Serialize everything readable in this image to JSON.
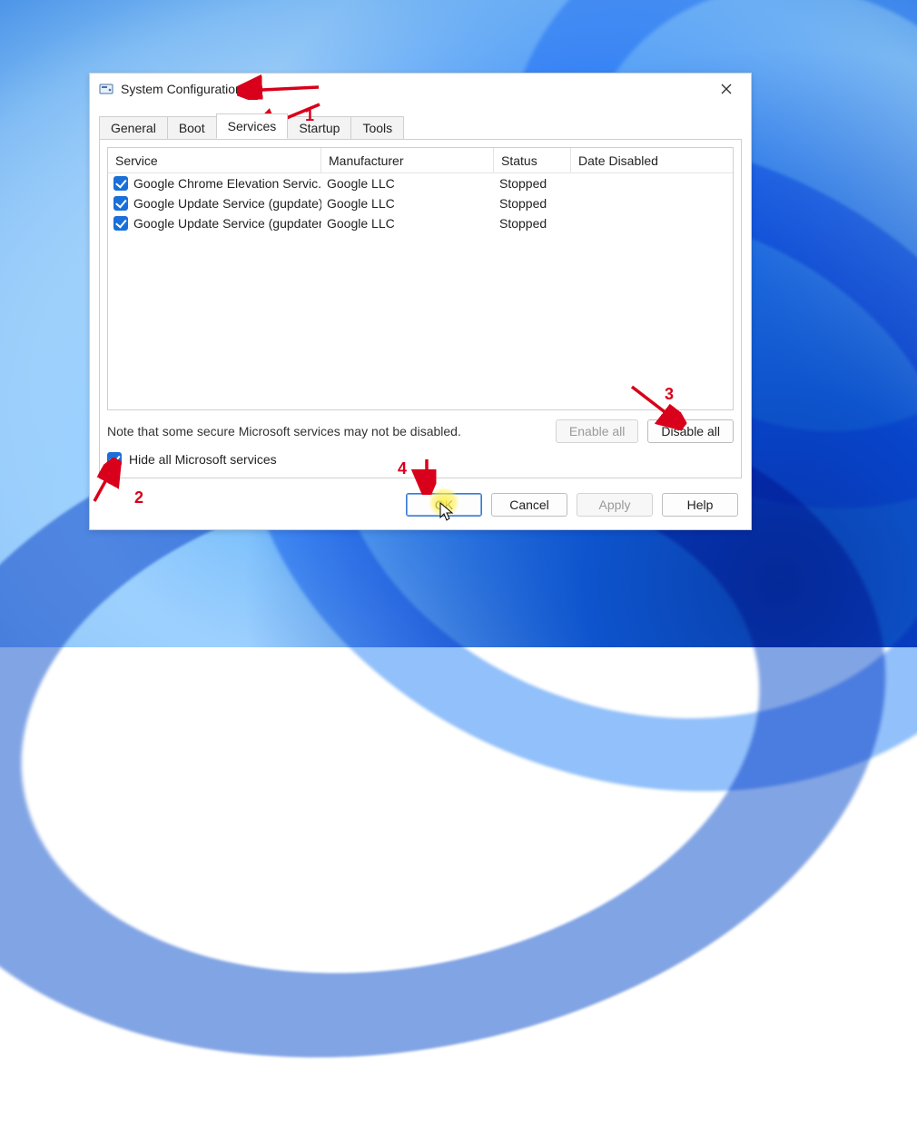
{
  "window": {
    "title": "System Configuration"
  },
  "tabs": {
    "general": "General",
    "boot": "Boot",
    "services": "Services",
    "startup": "Startup",
    "tools": "Tools",
    "active": "services"
  },
  "list": {
    "columns": {
      "service": "Service",
      "manufacturer": "Manufacturer",
      "status": "Status",
      "date_disabled": "Date Disabled"
    },
    "rows": [
      {
        "checked": true,
        "service": "Google Chrome Elevation Servic...",
        "manufacturer": "Google LLC",
        "status": "Stopped",
        "date_disabled": ""
      },
      {
        "checked": true,
        "service": "Google Update Service (gupdate)",
        "manufacturer": "Google LLC",
        "status": "Stopped",
        "date_disabled": ""
      },
      {
        "checked": true,
        "service": "Google Update Service (gupdatem)",
        "manufacturer": "Google LLC",
        "status": "Stopped",
        "date_disabled": ""
      }
    ]
  },
  "note": "Note that some secure Microsoft services may not be disabled.",
  "buttons": {
    "enable_all": "Enable all",
    "disable_all": "Disable all",
    "ok": "OK",
    "cancel": "Cancel",
    "apply": "Apply",
    "help": "Help"
  },
  "hide_ms": {
    "checked": true,
    "label": "Hide all Microsoft services"
  },
  "annotations": {
    "a1": "1",
    "a2": "2",
    "a3": "3",
    "a4": "4"
  }
}
